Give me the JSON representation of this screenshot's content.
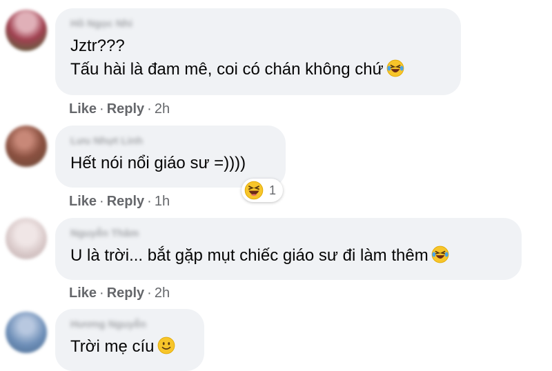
{
  "comments": [
    {
      "author": "Hồ Ngọc Nhi",
      "lines": [
        "Jztr???",
        "Tấu hài là đam mê, coi có chán không chứ"
      ],
      "emoji": "rolling-on-floor-laughing",
      "like": "Like",
      "reply": "Reply",
      "time": "2h",
      "avatar_color": "#a04050"
    },
    {
      "author": "Lưu Nhựt Linh",
      "lines": [
        "Hết nói nổi giáo sư =))))"
      ],
      "reaction": {
        "emoji": "laughing",
        "count": "1"
      },
      "like": "Like",
      "reply": "Reply",
      "time": "1h",
      "avatar_color": "#8a5040"
    },
    {
      "author": "Nguyễn Thâm",
      "lines": [
        "U là trời... bắt gặp mụt chiếc giáo sư đi làm thêm"
      ],
      "emoji": "rolling-on-floor-laughing",
      "like": "Like",
      "reply": "Reply",
      "time": "2h",
      "avatar_color": "#d8c8c8"
    },
    {
      "author": "Hương Nguyễn",
      "lines": [
        "Trời mẹ cíu"
      ],
      "emoji": "slightly-smiling-face",
      "avatar_color": "#6e8fb8"
    }
  ],
  "colors": {
    "bubble": "#f0f2f5",
    "text": "#050505",
    "muted": "#65676b",
    "emoji_yellow": "#f7c52a",
    "tears": "#4aa3e8"
  },
  "separator": "·"
}
